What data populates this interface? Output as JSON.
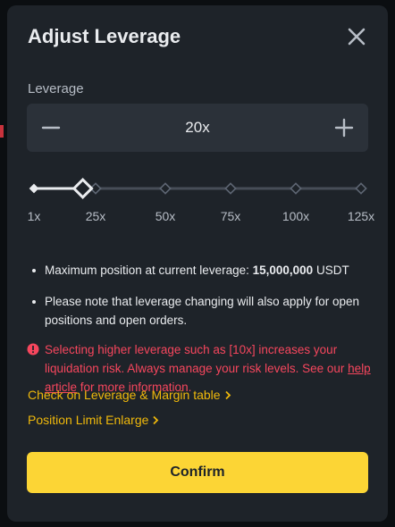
{
  "dialog": {
    "title": "Adjust Leverage",
    "close_icon": "close-icon"
  },
  "leverage": {
    "label": "Leverage",
    "value": "20x",
    "minus_icon": "minus-icon",
    "plus_icon": "plus-icon",
    "slider_level": 20,
    "slider_min": 1,
    "slider_max": 125
  },
  "ticks": [
    "1x",
    "25x",
    "50x",
    "75x",
    "100x",
    "125x"
  ],
  "info": {
    "max_position_prefix": "Maximum position at current leverage:",
    "max_position_value": "15,000,000",
    "max_position_unit": "USDT",
    "note": "Please note that leverage changing will also apply for open positions and open orders.",
    "warning_text": "Selecting higher leverage such as [10x] increases your liquidation risk. Always manage your risk levels. See our",
    "warning_link": "help article",
    "warning_suffix": "for more information."
  },
  "links": {
    "margin_table": "Check on Leverage & Margin table",
    "position_limit": "Position Limit Enlarge"
  },
  "confirm_label": "Confirm",
  "colors": {
    "accent": "#fcd535",
    "link": "#f0b90b",
    "warning": "#f6465d",
    "panel": "#1e2329",
    "field": "#2b3139"
  }
}
